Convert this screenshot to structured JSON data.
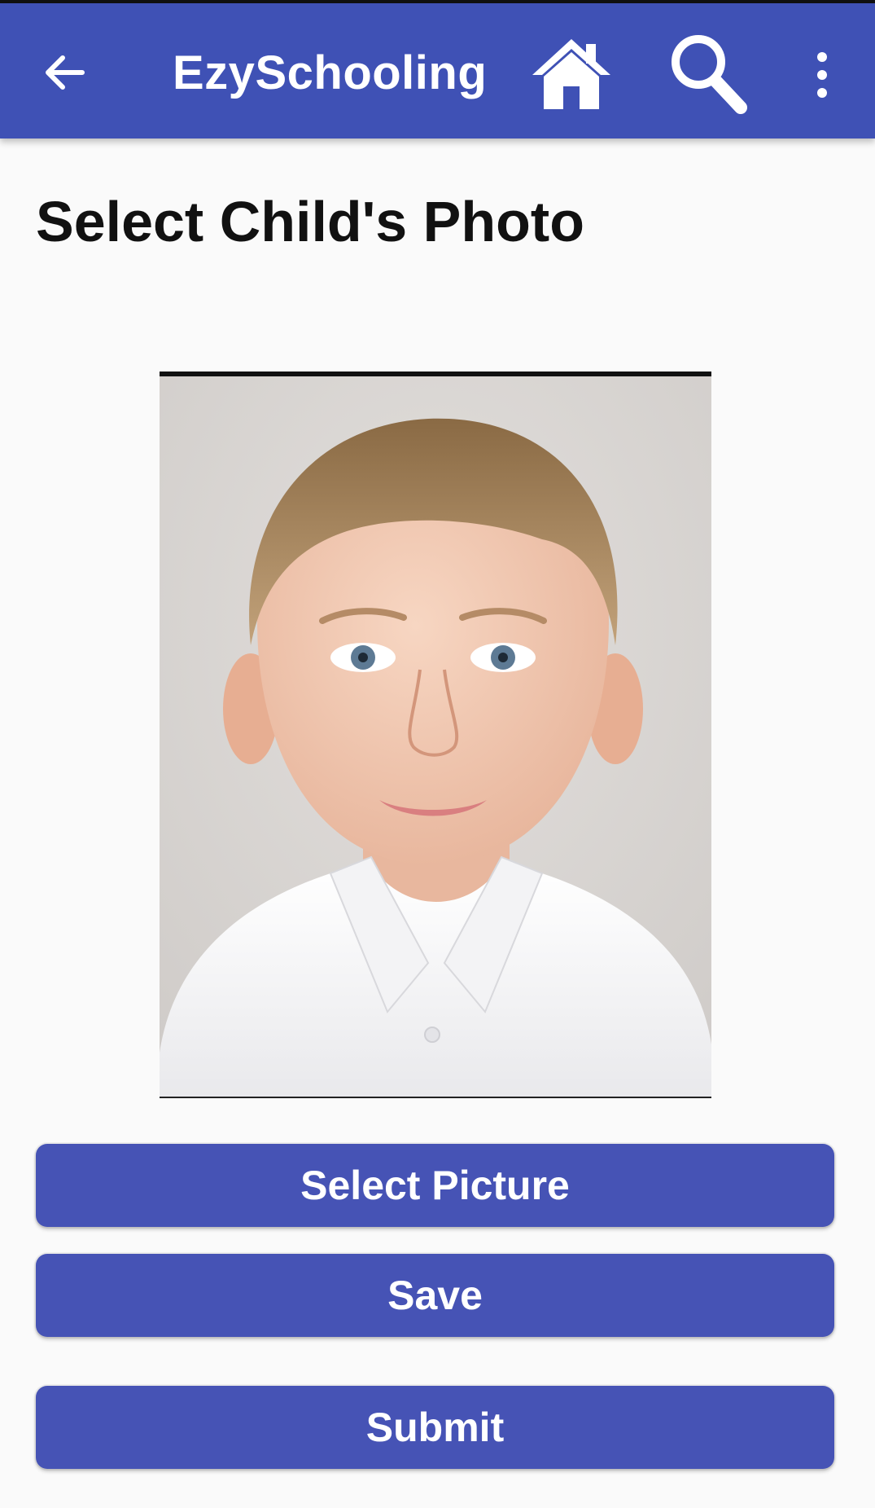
{
  "app_bar": {
    "title": "EzySchooling",
    "background_color": "#3f51b5",
    "icons": [
      "back-arrow-icon",
      "home-icon",
      "search-icon",
      "more-vert-icon"
    ]
  },
  "page": {
    "heading": "Select Child's Photo"
  },
  "photo": {
    "description_icon": "child-portrait-photo"
  },
  "buttons": {
    "select_picture": "Select Picture",
    "save": "Save",
    "submit": "Submit",
    "color": "#4653b5"
  }
}
